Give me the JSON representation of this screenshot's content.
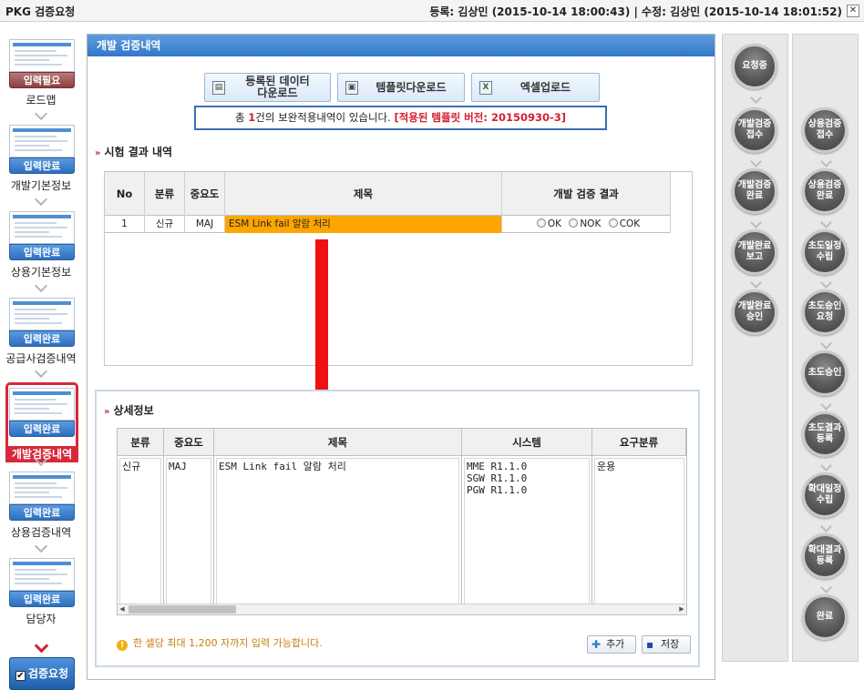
{
  "window": {
    "title": "PKG 검증요청",
    "reg_info": "등록: 김상민 (2015-10-14 18:00:43) | 수정: 김상민 (2015-10-14 18:01:52)",
    "close_glyph": "✕"
  },
  "steps": [
    {
      "badge": "입력필요",
      "label": "로드맵",
      "state": "need"
    },
    {
      "badge": "입력완료",
      "label": "개발기본정보",
      "state": "done"
    },
    {
      "badge": "입력완료",
      "label": "상용기본정보",
      "state": "done"
    },
    {
      "badge": "입력완료",
      "label": "공급사검증내역",
      "state": "done"
    },
    {
      "badge": "입력완료",
      "label": "개발검증내역",
      "state": "active"
    },
    {
      "badge": "입력완료",
      "label": "상용검증내역",
      "state": "done"
    },
    {
      "badge": "입력완료",
      "label": "담당자",
      "state": "done"
    }
  ],
  "request_button": {
    "label": "검증요청",
    "check": "✔"
  },
  "main": {
    "header": "개발 검증내역",
    "buttons": {
      "download_registered": "등록된 데이터\n다운로드",
      "template_download": "템플릿다운로드",
      "excel_upload": "엑셀업로드"
    },
    "notice": {
      "prefix": "총 ",
      "count": "1",
      "middle": "건의 보완적용내역이 있습니다. ",
      "template": "[적용된 템플릿 버전: 20150930-3]"
    },
    "result_section": {
      "title": "시험 결과 내역",
      "columns": [
        "No",
        "분류",
        "중요도",
        "제목",
        "개발 검증 결과"
      ],
      "row": {
        "no": "1",
        "category": "신규",
        "priority": "MAJ",
        "title": "ESM Link fail 알람 처리",
        "options": [
          "OK",
          "NOK",
          "COK"
        ]
      }
    },
    "detail_section": {
      "title": "상세정보",
      "columns": [
        "분류",
        "중요도",
        "제목",
        "시스템",
        "요구분류"
      ],
      "row": {
        "category": "신규",
        "priority": "MAJ",
        "title": "ESM Link fail 알람 처리",
        "system": "MME R1.1.0\nSGW R1.1.0\nPGW R1.1.0",
        "req_type": "운용"
      },
      "hint": "한 셀당 최대 1,200 자까지 입력 가능합니다.",
      "add_label": "추가",
      "save_label": "저장"
    }
  },
  "dev_status": [
    "요청중",
    "개발검증\n접수",
    "개발검증\n완료",
    "개발완료\n보고",
    "개발완료\n승인"
  ],
  "com_status": [
    "상용검증\n접수",
    "상용검증\n완료",
    "초도일정\n수립",
    "초도승인\n요청",
    "초도승인",
    "초도결과\n등록",
    "확대일정\n수립",
    "확대결과\n등록",
    "완료"
  ],
  "colors": {
    "accent": "#3277c8",
    "highlight": "#ffa500",
    "alert": "#d21f2f"
  }
}
